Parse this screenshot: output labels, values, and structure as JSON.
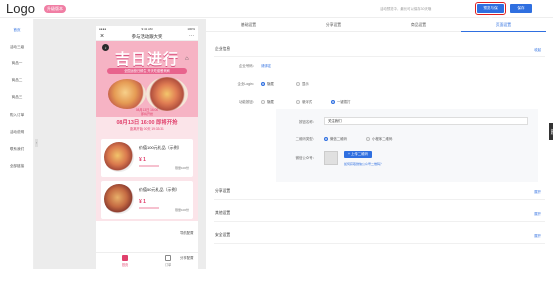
{
  "header": {
    "logo": "Logo",
    "badge": "升级版本",
    "hint": "活动预览中，最长可以保存30天哦",
    "save_label": "预览与保存",
    "next_label": "保存"
  },
  "sidebar": {
    "items": [
      {
        "label": "首页",
        "active": true
      },
      {
        "label": "活动三级"
      },
      {
        "label": "商品一"
      },
      {
        "label": "商品二"
      },
      {
        "label": "商品三"
      },
      {
        "label": "购入订单"
      },
      {
        "label": "活动说明"
      },
      {
        "label": "联系我们"
      },
      {
        "label": "全部链接"
      }
    ]
  },
  "phone": {
    "status_left": "●●●●",
    "status_time": "9:41 AM",
    "status_right": "100%",
    "nav_title": "参与活动跟大奖",
    "close_icon": "×",
    "more_icon": "···",
    "banner_title": "吉日进行",
    "banner_sub": "全国运营日鲜生 开天吃套餐来刷",
    "banner_time": "08月13日 16:00",
    "banner_time_label": "即将开抢",
    "countdown": "08月13日 16:00 即将开抢",
    "countdown_sub": "距离开始 00天 19:33:31",
    "cards": [
      {
        "name": "价值100元礼品（示例）",
        "price": "¥ 1",
        "stock": "限量100份"
      },
      {
        "name": "价值50元礼品（示例）",
        "price": "¥ 1",
        "stock": "限量100份"
      }
    ],
    "tabs": {
      "home": "首页",
      "orders": "订单"
    }
  },
  "side_buttons": {
    "nav": "导航配置",
    "share": "分享配置"
  },
  "tabs": [
    "基础设置",
    "分享设置",
    "商品设置",
    "页面设置"
  ],
  "sections": {
    "business": {
      "title": "企业信息",
      "toggle": "收起"
    },
    "share": {
      "title": "分享设置",
      "toggle": "展开"
    },
    "other": {
      "title": "其他设置",
      "toggle": "展开"
    },
    "security": {
      "title": "安全设置",
      "toggle": "展开"
    }
  },
  "fields": {
    "wechat_label": "企业号码：",
    "wechat_value": "请绑定",
    "login_label": "企业Login：",
    "login_opt1": "隐藏",
    "login_opt2": "显示",
    "func_label": "功能按钮：",
    "func_opt1": "隐藏",
    "func_opt2": "悬浮式",
    "func_opt3": "一键拨打",
    "func_btn_label": "按钮名称：",
    "func_btn_value": "关注我们",
    "qr_type_label": "二维码类型：",
    "qr_opt1": "微信二维码",
    "qr_opt2": "小程序二维码",
    "qr_upload_label": "微信公众号：",
    "upload_label": "+ 上传二维码",
    "qr_tip": "如何获取微信公众号二维码？"
  },
  "right_edge": "帮助"
}
